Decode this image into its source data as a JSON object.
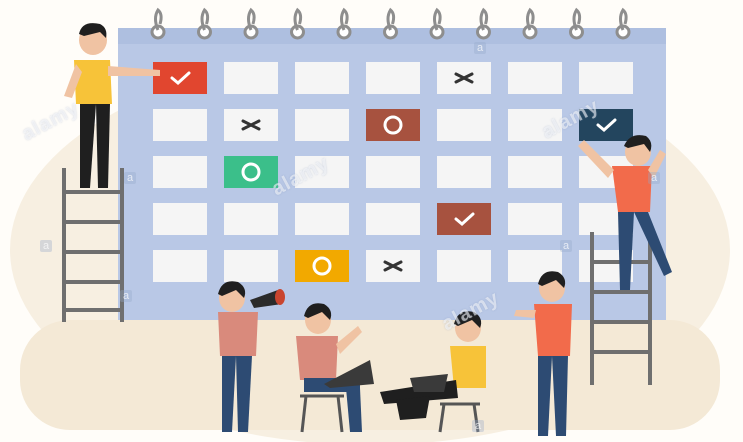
{
  "scene": {
    "subject": "calendar-planning-illustration",
    "colors": {
      "background": "#f7efe1",
      "calendar_board": "#b9c8e6",
      "cell": "#f5f5f5",
      "ring": "#8e8e8e",
      "red_mark": "#e1462f",
      "green_mark": "#3bbf8a",
      "brown_mark": "#a7523f",
      "yellow_mark": "#f2a900",
      "navy_mark": "#23455e",
      "shirt_yellow": "#f7c339",
      "shirt_red": "#f26b4b",
      "shirt_rose": "#d98a7c",
      "pants": "#2d4b73",
      "ladder": "#6f6f6f"
    },
    "calendar": {
      "rows": 5,
      "columns": 7,
      "marks": [
        {
          "row": 0,
          "col": 0,
          "symbol": "check",
          "color": "red_mark"
        },
        {
          "row": 0,
          "col": 4,
          "symbol": "cross",
          "color": "none"
        },
        {
          "row": 1,
          "col": 1,
          "symbol": "cross",
          "color": "none"
        },
        {
          "row": 1,
          "col": 3,
          "symbol": "circle",
          "color": "brown_mark"
        },
        {
          "row": 1,
          "col": 6,
          "symbol": "check",
          "color": "navy_mark"
        },
        {
          "row": 2,
          "col": 1,
          "symbol": "circle",
          "color": "green_mark"
        },
        {
          "row": 3,
          "col": 4,
          "symbol": "check",
          "color": "brown_mark"
        },
        {
          "row": 4,
          "col": 2,
          "symbol": "circle",
          "color": "yellow_mark"
        },
        {
          "row": 4,
          "col": 3,
          "symbol": "cross",
          "color": "none"
        }
      ]
    },
    "watermarks": [
      "alamy",
      "alamy",
      "alamy",
      "alamy"
    ],
    "watermark_small": "a"
  }
}
